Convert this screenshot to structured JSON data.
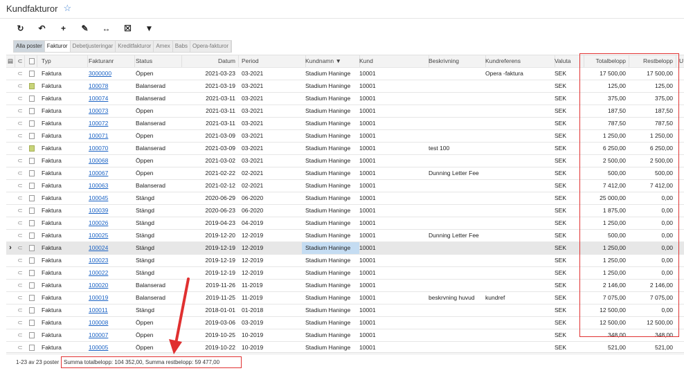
{
  "page": {
    "title": "Kundfakturor"
  },
  "toolbar": {
    "buttons": [
      {
        "name": "refresh-icon",
        "glyph": "↻"
      },
      {
        "name": "undo-icon",
        "glyph": "↶"
      },
      {
        "name": "add-icon",
        "glyph": "+"
      },
      {
        "name": "edit-icon",
        "glyph": "✎"
      },
      {
        "name": "fit-columns-icon",
        "glyph": "↔"
      },
      {
        "name": "clear-filter-icon",
        "glyph": "☒"
      },
      {
        "name": "filter-icon",
        "glyph": "▼"
      }
    ]
  },
  "tabs": [
    "Alla poster",
    "Fakturor",
    "Debetjusteringar",
    "Kreditfakturor",
    "Amex",
    "Babs",
    "Opera-fakturor"
  ],
  "columns": [
    "Typ",
    "Fakturanr",
    "Status",
    "Datum",
    "Period",
    "Kundnamn",
    "Kund",
    "Beskrivning",
    "Kundreferens",
    "Valuta",
    "Totalbelopp",
    "Restbelopp",
    "U"
  ],
  "rows": [
    {
      "icon": "plain",
      "typ": "Faktura",
      "nr": "3000000",
      "status": "Öppen",
      "datum": "2021-03-23",
      "period": "03-2021",
      "kundnamn": "Stadium Haninge",
      "kund": "10001",
      "beskrivning": "",
      "kundreferens": "Opera -faktura",
      "valuta": "SEK",
      "total": "17 500,00",
      "rest": "17 500,00"
    },
    {
      "icon": "green",
      "typ": "Faktura",
      "nr": "100078",
      "status": "Balanserad",
      "datum": "2021-03-19",
      "period": "03-2021",
      "kundnamn": "Stadium Haninge",
      "kund": "10001",
      "beskrivning": "",
      "kundreferens": "",
      "valuta": "SEK",
      "total": "125,00",
      "rest": "125,00"
    },
    {
      "icon": "plain",
      "typ": "Faktura",
      "nr": "100074",
      "status": "Balanserad",
      "datum": "2021-03-11",
      "period": "03-2021",
      "kundnamn": "Stadium Haninge",
      "kund": "10001",
      "beskrivning": "",
      "kundreferens": "",
      "valuta": "SEK",
      "total": "375,00",
      "rest": "375,00"
    },
    {
      "icon": "plain",
      "typ": "Faktura",
      "nr": "100073",
      "status": "Öppen",
      "datum": "2021-03-11",
      "period": "03-2021",
      "kundnamn": "Stadium Haninge",
      "kund": "10001",
      "beskrivning": "",
      "kundreferens": "",
      "valuta": "SEK",
      "total": "187,50",
      "rest": "187,50"
    },
    {
      "icon": "plain",
      "typ": "Faktura",
      "nr": "100072",
      "status": "Balanserad",
      "datum": "2021-03-11",
      "period": "03-2021",
      "kundnamn": "Stadium Haninge",
      "kund": "10001",
      "beskrivning": "",
      "kundreferens": "",
      "valuta": "SEK",
      "total": "787,50",
      "rest": "787,50"
    },
    {
      "icon": "plain",
      "typ": "Faktura",
      "nr": "100071",
      "status": "Öppen",
      "datum": "2021-03-09",
      "period": "03-2021",
      "kundnamn": "Stadium Haninge",
      "kund": "10001",
      "beskrivning": "",
      "kundreferens": "",
      "valuta": "SEK",
      "total": "1 250,00",
      "rest": "1 250,00"
    },
    {
      "icon": "green",
      "typ": "Faktura",
      "nr": "100070",
      "status": "Balanserad",
      "datum": "2021-03-09",
      "period": "03-2021",
      "kundnamn": "Stadium Haninge",
      "kund": "10001",
      "beskrivning": "test 100",
      "kundreferens": "",
      "valuta": "SEK",
      "total": "6 250,00",
      "rest": "6 250,00"
    },
    {
      "icon": "plain",
      "typ": "Faktura",
      "nr": "100068",
      "status": "Öppen",
      "datum": "2021-03-02",
      "period": "03-2021",
      "kundnamn": "Stadium Haninge",
      "kund": "10001",
      "beskrivning": "",
      "kundreferens": "",
      "valuta": "SEK",
      "total": "2 500,00",
      "rest": "2 500,00"
    },
    {
      "icon": "plain",
      "typ": "Faktura",
      "nr": "100067",
      "status": "Öppen",
      "datum": "2021-02-22",
      "period": "02-2021",
      "kundnamn": "Stadium Haninge",
      "kund": "10001",
      "beskrivning": "Dunning Letter Fee",
      "kundreferens": "",
      "valuta": "SEK",
      "total": "500,00",
      "rest": "500,00"
    },
    {
      "icon": "plain",
      "typ": "Faktura",
      "nr": "100063",
      "status": "Balanserad",
      "datum": "2021-02-12",
      "period": "02-2021",
      "kundnamn": "Stadium Haninge",
      "kund": "10001",
      "beskrivning": "",
      "kundreferens": "",
      "valuta": "SEK",
      "total": "7 412,00",
      "rest": "7 412,00"
    },
    {
      "icon": "plain",
      "typ": "Faktura",
      "nr": "100045",
      "status": "Stängd",
      "datum": "2020-06-29",
      "period": "06-2020",
      "kundnamn": "Stadium Haninge",
      "kund": "10001",
      "beskrivning": "",
      "kundreferens": "",
      "valuta": "SEK",
      "total": "25 000,00",
      "rest": "0,00"
    },
    {
      "icon": "plain",
      "typ": "Faktura",
      "nr": "100039",
      "status": "Stängd",
      "datum": "2020-06-23",
      "period": "06-2020",
      "kundnamn": "Stadium Haninge",
      "kund": "10001",
      "beskrivning": "",
      "kundreferens": "",
      "valuta": "SEK",
      "total": "1 875,00",
      "rest": "0,00"
    },
    {
      "icon": "plain",
      "typ": "Faktura",
      "nr": "100026",
      "status": "Stängd",
      "datum": "2019-04-23",
      "period": "04-2019",
      "kundnamn": "Stadium Haninge",
      "kund": "10001",
      "beskrivning": "",
      "kundreferens": "",
      "valuta": "SEK",
      "total": "1 250,00",
      "rest": "0,00"
    },
    {
      "icon": "plain",
      "typ": "Faktura",
      "nr": "100025",
      "status": "Stängd",
      "datum": "2019-12-20",
      "period": "12-2019",
      "kundnamn": "Stadium Haninge",
      "kund": "10001",
      "beskrivning": "Dunning Letter Fee",
      "kundreferens": "",
      "valuta": "SEK",
      "total": "500,00",
      "rest": "0,00"
    },
    {
      "icon": "plain",
      "typ": "Faktura",
      "nr": "100024",
      "status": "Stängd",
      "datum": "2019-12-19",
      "period": "12-2019",
      "kundnamn": "Stadium Haninge",
      "kund": "10001",
      "beskrivning": "",
      "kundreferens": "",
      "valuta": "SEK",
      "total": "1 250,00",
      "rest": "0,00",
      "current": true
    },
    {
      "icon": "plain",
      "typ": "Faktura",
      "nr": "100023",
      "status": "Stängd",
      "datum": "2019-12-19",
      "period": "12-2019",
      "kundnamn": "Stadium Haninge",
      "kund": "10001",
      "beskrivning": "",
      "kundreferens": "",
      "valuta": "SEK",
      "total": "1 250,00",
      "rest": "0,00"
    },
    {
      "icon": "plain",
      "typ": "Faktura",
      "nr": "100022",
      "status": "Stängd",
      "datum": "2019-12-19",
      "period": "12-2019",
      "kundnamn": "Stadium Haninge",
      "kund": "10001",
      "beskrivning": "",
      "kundreferens": "",
      "valuta": "SEK",
      "total": "1 250,00",
      "rest": "0,00"
    },
    {
      "icon": "plain",
      "typ": "Faktura",
      "nr": "100020",
      "status": "Balanserad",
      "datum": "2019-11-26",
      "period": "11-2019",
      "kundnamn": "Stadium Haninge",
      "kund": "10001",
      "beskrivning": "",
      "kundreferens": "",
      "valuta": "SEK",
      "total": "2 146,00",
      "rest": "2 146,00"
    },
    {
      "icon": "plain",
      "typ": "Faktura",
      "nr": "100019",
      "status": "Balanserad",
      "datum": "2019-11-25",
      "period": "11-2019",
      "kundnamn": "Stadium Haninge",
      "kund": "10001",
      "beskrivning": "beskrvning huvud",
      "kundreferens": "kundref",
      "valuta": "SEK",
      "total": "7 075,00",
      "rest": "7 075,00"
    },
    {
      "icon": "plain",
      "typ": "Faktura",
      "nr": "100011",
      "status": "Stängd",
      "datum": "2018-01-01",
      "period": "01-2018",
      "kundnamn": "Stadium Haninge",
      "kund": "10001",
      "beskrivning": "",
      "kundreferens": "",
      "valuta": "SEK",
      "total": "12 500,00",
      "rest": "0,00"
    },
    {
      "icon": "plain",
      "typ": "Faktura",
      "nr": "100008",
      "status": "Öppen",
      "datum": "2019-03-06",
      "period": "03-2019",
      "kundnamn": "Stadium Haninge",
      "kund": "10001",
      "beskrivning": "",
      "kundreferens": "",
      "valuta": "SEK",
      "total": "12 500,00",
      "rest": "12 500,00"
    },
    {
      "icon": "plain",
      "typ": "Faktura",
      "nr": "100007",
      "status": "Öppen",
      "datum": "2019-10-25",
      "period": "10-2019",
      "kundnamn": "Stadium Haninge",
      "kund": "10001",
      "beskrivning": "",
      "kundreferens": "",
      "valuta": "SEK",
      "total": "348,00",
      "rest": "348,00"
    },
    {
      "icon": "plain",
      "typ": "Faktura",
      "nr": "100005",
      "status": "Öppen",
      "datum": "2019-10-22",
      "period": "10-2019",
      "kundnamn": "Stadium Haninge",
      "kund": "10001",
      "beskrivning": "",
      "kundreferens": "",
      "valuta": "SEK",
      "total": "521,00",
      "rest": "521,00"
    }
  ],
  "footer": {
    "count": "1-23 av 23 poster",
    "summary": "Summa totalbelopp: 104 352,00, Summa restbelopp: 59 477,00"
  },
  "colors": {
    "link": "#1a62c4",
    "highlight": "#e03030",
    "selected_cell": "#c4dcf2"
  }
}
